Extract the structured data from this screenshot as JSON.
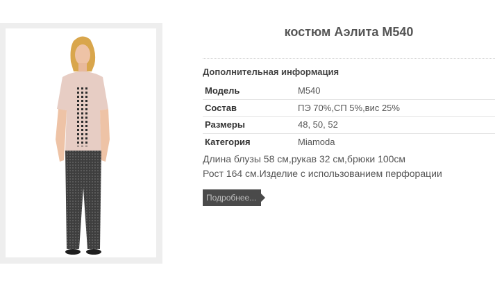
{
  "product": {
    "title": "костюм Аэлита М540",
    "image_alt": "костюм Аэлита М540"
  },
  "info": {
    "heading": "Дополнительная информация",
    "rows": [
      {
        "label": "Модель",
        "value": "М540"
      },
      {
        "label": "Состав",
        "value": "ПЭ 70%,СП 5%,вис 25%"
      },
      {
        "label": "Размеры",
        "value": "48, 50, 52"
      },
      {
        "label": "Категория",
        "value": "Miamoda"
      }
    ]
  },
  "description": {
    "line1": "Длина блузы 58 см,рукав 32 см,брюки 100см",
    "line2": "Рост 164 см.Изделие с использованием перфорации"
  },
  "more_button": {
    "label": "Подробнее..."
  }
}
